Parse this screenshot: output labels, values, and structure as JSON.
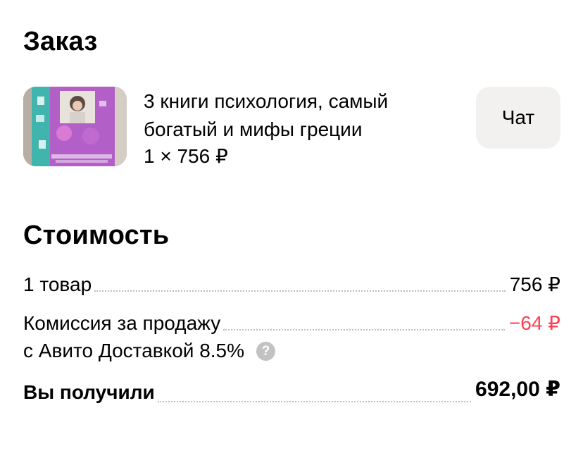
{
  "order": {
    "title": "Заказ",
    "product_name": "3 книги психология, самый богатый и мифы греции",
    "product_price": "1 × 756 ₽",
    "chat_label": "Чат",
    "thumb_colors": {
      "cover_teal": "#3fb5ad",
      "cover_purple": "#b35fc8",
      "background": "#cfc6bd"
    }
  },
  "cost": {
    "title": "Стоимость",
    "items_label": "1 товар",
    "items_value": "756 ₽",
    "commission_label_line1": "Комиссия за продажу",
    "commission_label_line2": "с Авито Доставкой 8.5%",
    "commission_value": "−64 ₽",
    "help_icon": "question-icon",
    "total_label": "Вы получили",
    "total_value": "692,00 ₽"
  },
  "colors": {
    "negative": "#ff4053",
    "chat_bg": "#f2f1f0",
    "help_icon_bg": "#c2c2c2"
  }
}
